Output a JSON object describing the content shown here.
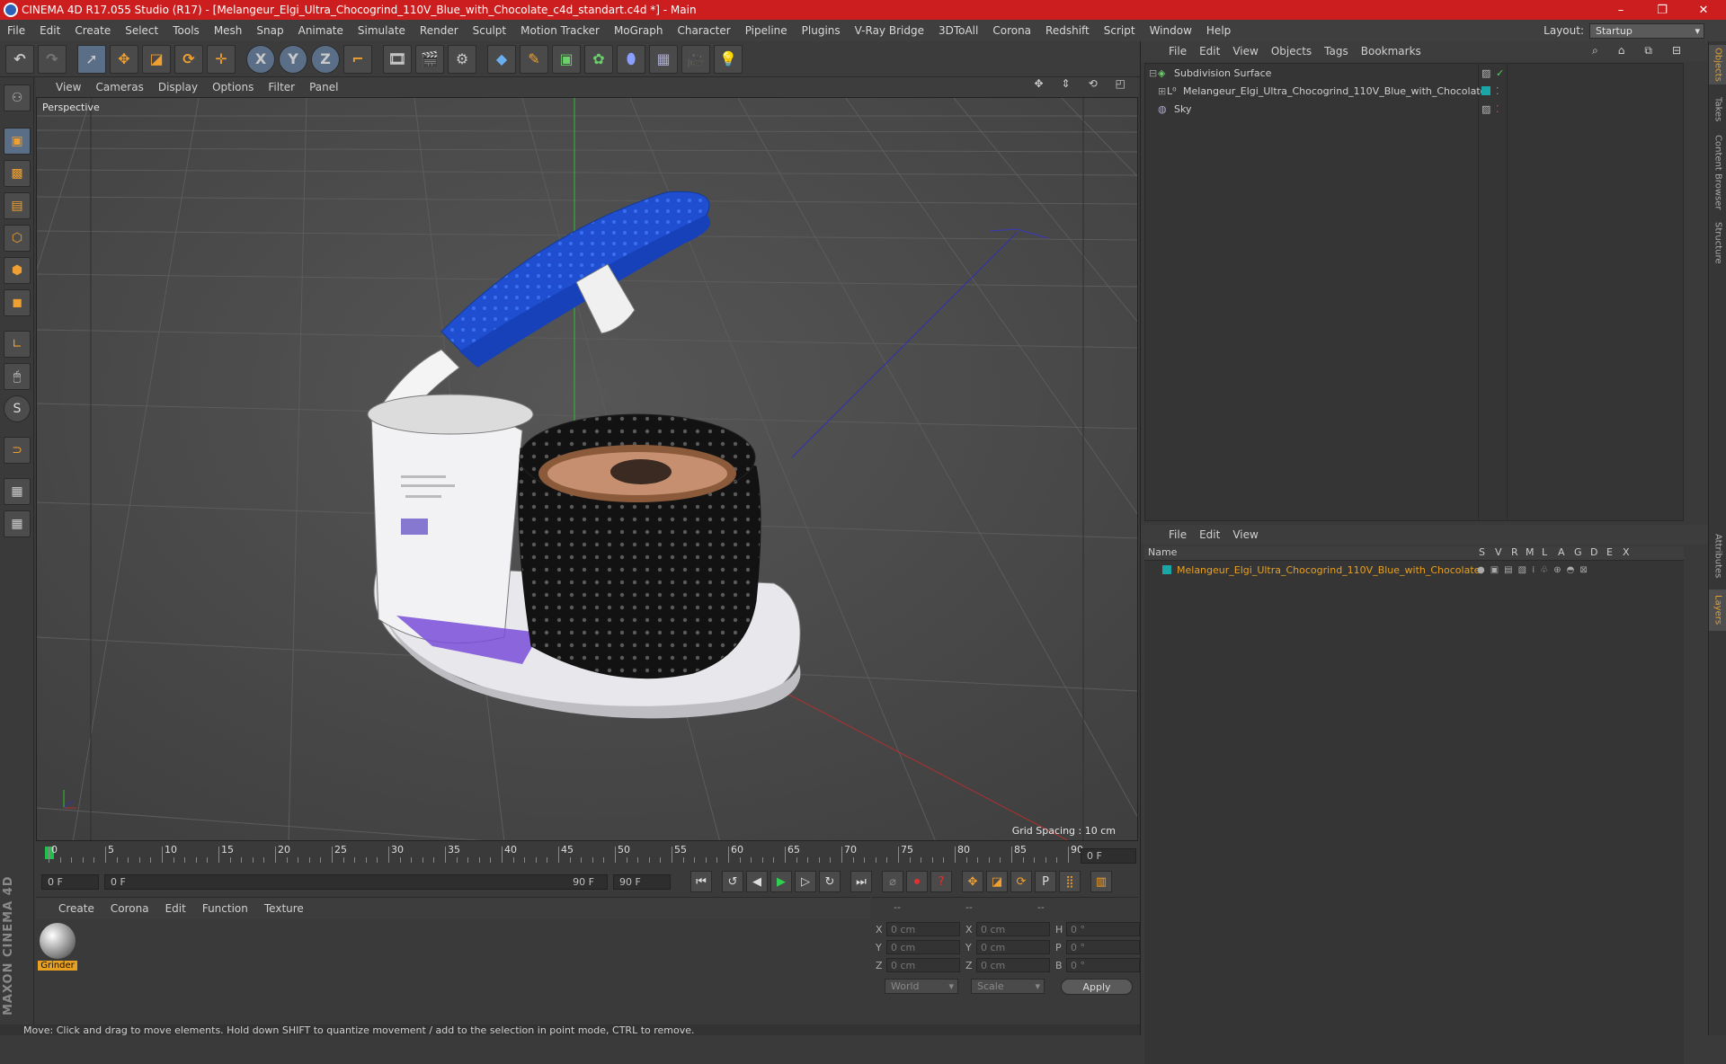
{
  "window": {
    "title": "CINEMA 4D R17.055 Studio (R17) - [Melangeur_Elgi_Ultra_Chocogrind_110V_Blue_with_Chocolate_c4d_standart.c4d *] - Main",
    "minimize": "–",
    "restore": "❐",
    "close": "✕"
  },
  "menubar": [
    "File",
    "Edit",
    "Create",
    "Select",
    "Tools",
    "Mesh",
    "Snap",
    "Animate",
    "Simulate",
    "Render",
    "Sculpt",
    "Motion Tracker",
    "MoGraph",
    "Character",
    "Pipeline",
    "Plugins",
    "V-Ray Bridge",
    "3DToAll",
    "Corona",
    "Redshift",
    "Script",
    "Window",
    "Help"
  ],
  "layout": {
    "label": "Layout:",
    "value": "Startup"
  },
  "toolbar": {
    "x_axis": "X",
    "y_axis": "Y",
    "z_axis": "Z"
  },
  "viewport": {
    "menu": [
      "View",
      "Cameras",
      "Display",
      "Options",
      "Filter",
      "Panel"
    ],
    "camera_label": "Perspective",
    "grid_spacing": "Grid Spacing : 10 cm"
  },
  "timeline": {
    "ticks": [
      "0",
      "5",
      "10",
      "15",
      "20",
      "25",
      "30",
      "35",
      "40",
      "45",
      "50",
      "55",
      "60",
      "65",
      "70",
      "75",
      "80",
      "85",
      "90"
    ],
    "current_frame": "0 F",
    "start_field": "0 F",
    "range_start": "0 F",
    "range_end": "90 F",
    "end_field": "90 F"
  },
  "material_panel": {
    "menu": [
      "Create",
      "Corona",
      "Edit",
      "Function",
      "Texture"
    ],
    "materials": [
      {
        "name": "Grinder"
      }
    ]
  },
  "coord_panel": {
    "headers": [
      "--",
      "--",
      "--"
    ],
    "rows": [
      {
        "l1": "X",
        "v1": "0 cm",
        "l2": "X",
        "v2": "0 cm",
        "l3": "H",
        "v3": "0 °"
      },
      {
        "l1": "Y",
        "v1": "0 cm",
        "l2": "Y",
        "v2": "0 cm",
        "l3": "P",
        "v3": "0 °"
      },
      {
        "l1": "Z",
        "v1": "0 cm",
        "l2": "Z",
        "v2": "0 cm",
        "l3": "B",
        "v3": "0 °"
      }
    ],
    "world": "World",
    "scale": "Scale",
    "apply": "Apply"
  },
  "object_manager": {
    "menu": [
      "File",
      "Edit",
      "View",
      "Objects",
      "Tags",
      "Bookmarks"
    ],
    "objects": [
      {
        "name": "Subdivision Surface"
      },
      {
        "name": "Melangeur_Elgi_Ultra_Chocogrind_110V_Blue_with_Chocolate"
      },
      {
        "name": "Sky"
      }
    ]
  },
  "layer_manager": {
    "menu": [
      "File",
      "Edit",
      "View"
    ],
    "columns": [
      "Name",
      "S",
      "V",
      "R",
      "M",
      "L",
      "A",
      "G",
      "D",
      "E",
      "X"
    ],
    "layers": [
      {
        "name": "Melangeur_Elgi_Ultra_Chocogrind_110V_Blue_with_Chocolate",
        "color": "#1aa6a6"
      }
    ]
  },
  "side_tabs": [
    "Objects",
    "Takes",
    "Content Browser",
    "Structure",
    "Attributes",
    "Layers"
  ],
  "status": "Move: Click and drag to move elements. Hold down SHIFT to quantize movement / add to the selection in point mode, CTRL to remove.",
  "logo": "MAXON CINEMA 4D",
  "colors": {
    "title_red": "#cc1e1e",
    "accent_orange": "#f0a030",
    "layer_name": "#e8a020"
  }
}
